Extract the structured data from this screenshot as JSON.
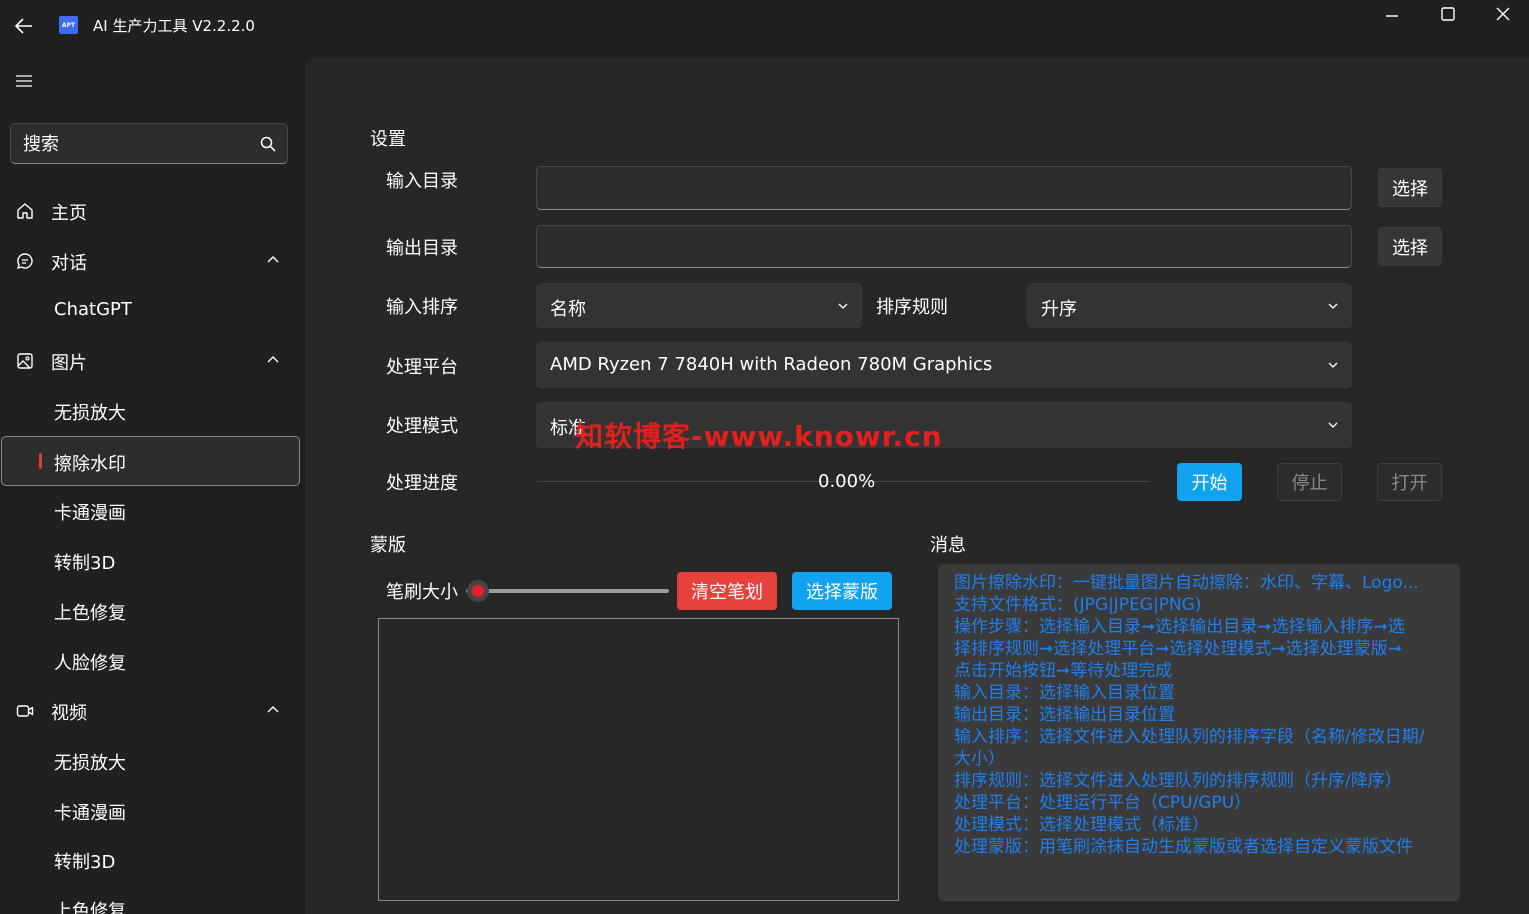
{
  "titlebar": {
    "app_logo_text": "APT",
    "title": "AI 生产力工具 V2.2.2.0",
    "icons": [
      "back-arrow-icon",
      "minimize-icon",
      "maximize-icon",
      "close-icon"
    ]
  },
  "sidebar": {
    "menu_icon": "hamburger-icon",
    "search_placeholder": "搜索",
    "items": [
      {
        "label": "主页",
        "icon": "home-icon"
      },
      {
        "label": "对话",
        "icon": "chat-icon",
        "expanded": true
      },
      {
        "label": "ChatGPT"
      },
      {
        "label": "图片",
        "icon": "image-icon",
        "expanded": true
      },
      {
        "label": "无损放大"
      },
      {
        "label": "擦除水印",
        "selected": true
      },
      {
        "label": "卡通漫画"
      },
      {
        "label": "转制3D"
      },
      {
        "label": "上色修复"
      },
      {
        "label": "人脸修复"
      },
      {
        "label": "视频",
        "icon": "video-icon",
        "expanded": true
      },
      {
        "label": "无损放大"
      },
      {
        "label": "卡通漫画"
      },
      {
        "label": "转制3D"
      },
      {
        "label": "上色修复"
      }
    ]
  },
  "settings": {
    "section_title": "设置",
    "input_dir_label": "输入目录",
    "output_dir_label": "输出目录",
    "input_dir_value": "",
    "output_dir_value": "",
    "choose_label": "选择",
    "sort_label": "输入排序",
    "sort_value": "名称",
    "sort_rule_label": "排序规则",
    "sort_rule_value": "升序",
    "platform_label": "处理平台",
    "platform_value": "AMD Ryzen 7 7840H with Radeon 780M Graphics",
    "mode_label": "处理模式",
    "mode_value": "标准",
    "progress_label": "处理进度",
    "progress_text": "0.00%",
    "progress_fraction": 0.0,
    "start_label": "开始",
    "stop_label": "停止",
    "open_label": "打开"
  },
  "overlay": {
    "watermark_text": "知软博客-www.knowr.cn",
    "color": "#e3201e"
  },
  "mask": {
    "section_title": "蒙版",
    "brush_label": "笔刷大小",
    "brush_fraction": 0.06,
    "clear_label": "清空笔划",
    "choose_mask_label": "选择蒙版"
  },
  "messages": {
    "section_title": "消息",
    "lines": [
      "图片擦除水印：一键批量图片自动擦除：水印、字幕、Logo...",
      "支持文件格式：(JPG|JPEG|PNG)",
      "操作步骤：选择输入目录➞选择输出目录➞选择输入排序➞选",
      "择排序规则➞选择处理平台➞选择处理模式➞选择处理蒙版➞",
      "点击开始按钮➞等待处理完成",
      "输入目录：选择输入目录位置",
      "输出目录：选择输出目录位置",
      "输入排序：选择文件进入处理队列的排序字段（名称/修改日期/",
      "大小）",
      "排序规则：选择文件进入处理队列的排序规则（升序/降序）",
      "处理平台：处理运行平台（CPU/GPU）",
      "处理模式：选择处理模式（标准）",
      "处理蒙版：用笔刷涂抹自动生成蒙版或者选择自定义蒙版文件"
    ]
  },
  "colors": {
    "accent_blue": "#11a3f0",
    "danger_red": "#e6413d",
    "message_text": "#1f7ff0"
  }
}
